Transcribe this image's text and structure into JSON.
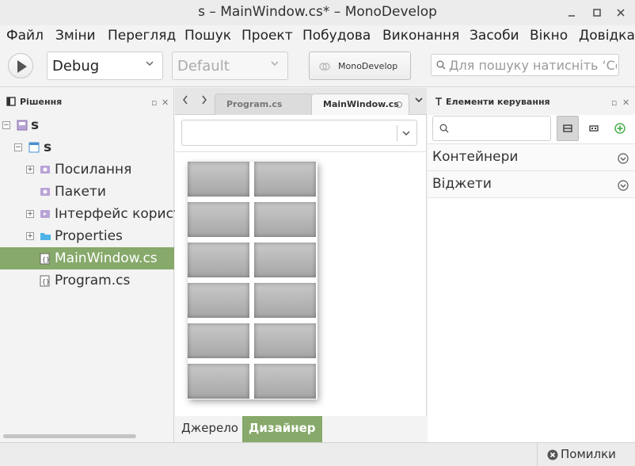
{
  "window": {
    "title": "s – MainWindow.cs* – MonoDevelop",
    "minimize_label": "–",
    "maximize_label": "□",
    "close_label": "✕"
  },
  "menu": [
    "Файл",
    "Зміни",
    "Перегляд",
    "Пошук",
    "Проект",
    "Побудова",
    "Виконання",
    "Засоби",
    "Вікно",
    "Довідка"
  ],
  "toolbar": {
    "config_value": "Debug",
    "platform_value": "Default",
    "status_label": "MonoDevelop",
    "search_placeholder": "Для пошуку натисніть ‘Control+,’"
  },
  "solution_pad": {
    "title": "Рішення",
    "items": [
      {
        "label": "s",
        "icon": "solution-icon",
        "bold": true
      },
      {
        "label": "s",
        "icon": "project-icon",
        "bold": true
      },
      {
        "label": "Посилання",
        "icon": "references-folder-icon"
      },
      {
        "label": "Пакети",
        "icon": "packages-folder-icon"
      },
      {
        "label": "Інтерфейс користувача",
        "icon": "ui-folder-icon"
      },
      {
        "label": "Properties",
        "icon": "folder-icon"
      },
      {
        "label": "MainWindow.cs",
        "icon": "cs-file-icon",
        "selected": true
      },
      {
        "label": "Program.cs",
        "icon": "cs-file-icon"
      }
    ]
  },
  "editor": {
    "tabs": [
      {
        "label": "Program.cs",
        "active": false
      },
      {
        "label": "MainWindow.cs",
        "active": true
      }
    ],
    "bottom_tabs": [
      {
        "label": "Джерело",
        "active": false
      },
      {
        "label": "Дизайнер",
        "active": true
      }
    ]
  },
  "toolbox": {
    "title": "Елементи керування",
    "categories": [
      "Контейнери",
      "Віджети"
    ]
  },
  "statusbar": {
    "errors_label": "Помилки"
  },
  "colors": {
    "selection": "#87a96b",
    "panel_bg": "#f3f3f3"
  }
}
